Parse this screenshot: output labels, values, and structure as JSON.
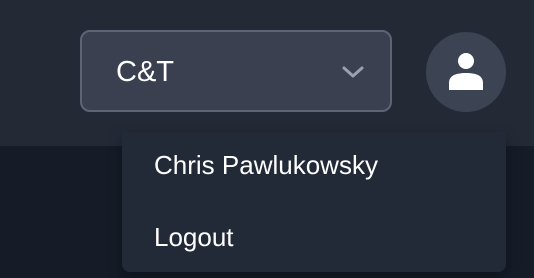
{
  "header": {
    "org_select": {
      "selected_value": "C&T",
      "icon": "chevron-down-icon"
    },
    "avatar": {
      "icon": "user-icon"
    }
  },
  "user_menu": {
    "user_name": "Chris Pawlukowsky",
    "logout_label": "Logout"
  },
  "colors": {
    "page_background": "#151c28",
    "header_background": "#232a36",
    "select_background": "#3a4050",
    "select_border": "#5c6475",
    "menu_background": "#222a37",
    "text": "#ffffff",
    "chevron": "#9aa0ad"
  }
}
